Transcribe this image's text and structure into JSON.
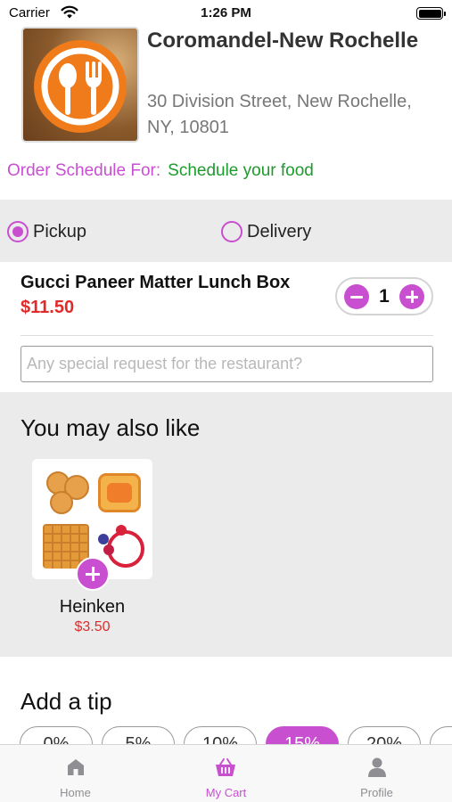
{
  "status_bar": {
    "carrier": "Carrier",
    "time": "1:26 PM"
  },
  "restaurant": {
    "name": "Coromandel-New Rochelle",
    "address": "30 Division Street, New Rochelle, NY, 10801",
    "logo_icon": "fork-spoon-plate-icon"
  },
  "schedule": {
    "label": "Order Schedule For:",
    "value": "Schedule your food"
  },
  "order_type": {
    "pickup_label": "Pickup",
    "delivery_label": "Delivery",
    "selected": "Pickup"
  },
  "cart_item": {
    "name": "Gucci Paneer Matter Lunch Box",
    "price": "$11.50",
    "quantity": "1"
  },
  "special_request": {
    "placeholder": "Any special request for the restaurant?",
    "value": ""
  },
  "suggestions": {
    "title": "You may also like",
    "items": [
      {
        "name": "Heinken",
        "price": "$3.50"
      }
    ]
  },
  "tip": {
    "title": "Add a tip",
    "options": [
      "0%",
      "5%",
      "10%",
      "15%",
      "20%"
    ],
    "selected": "15%"
  },
  "tab_bar": {
    "items": [
      {
        "label": "Home",
        "icon": "home-icon"
      },
      {
        "label": "My Cart",
        "icon": "basket-icon"
      },
      {
        "label": "Profile",
        "icon": "person-icon"
      }
    ],
    "active": "My Cart"
  },
  "colors": {
    "accent": "#c84fd0",
    "price": "#e02b2b",
    "schedule_value": "#1f9a2e",
    "logo_orange": "#f07b1a"
  }
}
